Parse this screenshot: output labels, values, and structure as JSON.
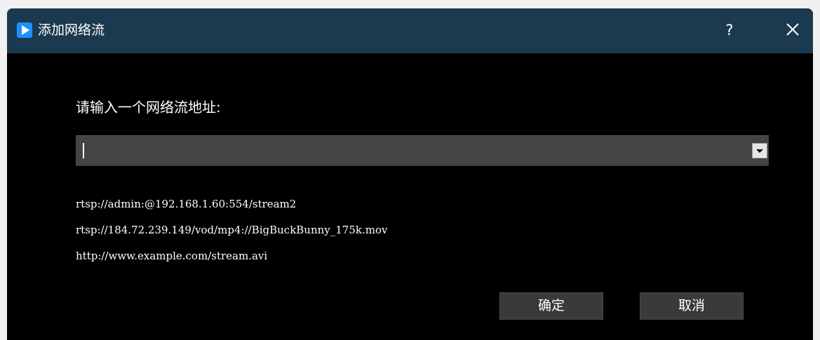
{
  "window": {
    "title": "添加网络流",
    "help_label": "?",
    "accent": "#1e90ff",
    "titlebar_color": "#1b3a4f"
  },
  "icons": {
    "app": "play-icon",
    "close": "close-icon",
    "dropdown": "chevron-down-icon"
  },
  "form": {
    "prompt": "请输入一个网络流地址:",
    "url_value": "",
    "url_placeholder": ""
  },
  "examples": [
    "rtsp://admin:@192.168.1.60:554/stream2",
    "rtsp://184.72.239.149/vod/mp4://BigBuckBunny_175k.mov",
    "http://www.example.com/stream.avi"
  ],
  "buttons": {
    "ok": "确定",
    "cancel": "取消"
  }
}
